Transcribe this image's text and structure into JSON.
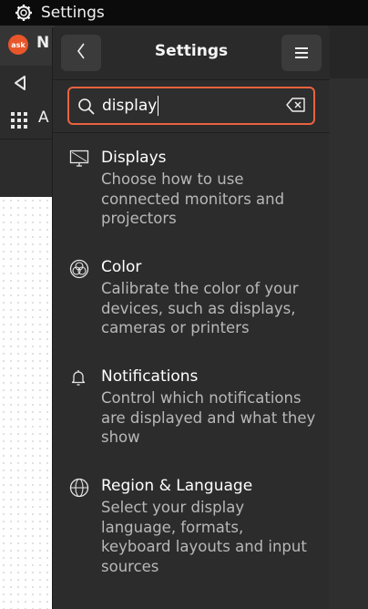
{
  "topbar": {
    "app_name": "Settings"
  },
  "background_window": {
    "tab_text": "N",
    "ask_logo": "ask",
    "apps_label": "A"
  },
  "settings": {
    "title": "Settings",
    "search": {
      "value": "display",
      "placeholder": ""
    },
    "results": [
      {
        "icon": "display-icon",
        "title": "Displays",
        "description": "Choose how to use connected monitors and projectors"
      },
      {
        "icon": "color-icon",
        "title": "Color",
        "description": "Calibrate the color of your devices, such as displays, cameras or printers"
      },
      {
        "icon": "bell-icon",
        "title": "Notifications",
        "description": "Control which notifications are displayed and what they show"
      },
      {
        "icon": "globe-icon",
        "title": "Region & Language",
        "description": "Select your display language, formats, keyboard layouts and input sources"
      }
    ]
  },
  "colors": {
    "accent": "#e9633f",
    "panel": "#2c2c2c",
    "topbar": "#0b0b0b"
  }
}
